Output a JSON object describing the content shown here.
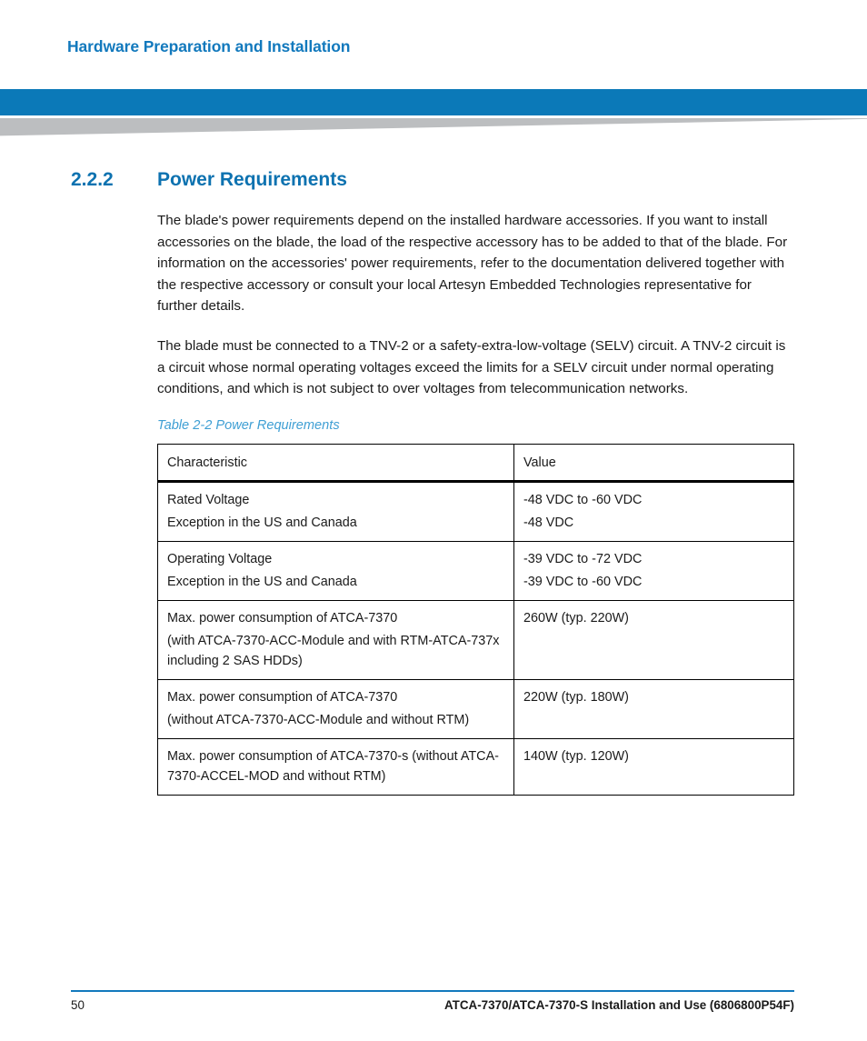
{
  "header": {
    "title": "Hardware Preparation and Installation",
    "accent_color": "#0b79b8",
    "title_color": "#1279bd"
  },
  "section": {
    "number": "2.2.2",
    "title": "Power Requirements",
    "heading_color": "#0d72b0"
  },
  "paragraphs": [
    "The blade's power requirements depend on the installed hardware accessories. If you want to install accessories on the blade, the load of the respective accessory has to be added to that of the blade. For information on the accessories' power requirements, refer to the documentation delivered together with the respective accessory or consult your local Artesyn Embedded Technologies representative for further details.",
    "The blade must be connected to a TNV-2 or a safety-extra-low-voltage (SELV) circuit. A TNV-2 circuit is a circuit whose normal operating voltages exceed the limits for a SELV circuit under normal operating conditions, and which is not subject to over voltages from telecommunication networks."
  ],
  "table": {
    "caption": "Table 2-2 Power Requirements",
    "caption_color": "#3f9fd4",
    "columns": [
      "Characteristic",
      "Value"
    ],
    "rows": [
      {
        "characteristic_lines": [
          "Rated Voltage",
          "Exception in the US and Canada"
        ],
        "value_lines": [
          "-48 VDC  to -60 VDC",
          "-48 VDC"
        ]
      },
      {
        "characteristic_lines": [
          "Operating Voltage",
          "Exception in the US and Canada"
        ],
        "value_lines": [
          "-39 VDC to -72 VDC",
          "-39 VDC to -60 VDC"
        ]
      },
      {
        "characteristic_lines": [
          "Max. power consumption of ATCA-7370",
          "(with ATCA-7370-ACC-Module and with RTM-ATCA-737x including 2 SAS HDDs)"
        ],
        "value_lines": [
          "260W (typ. 220W)"
        ]
      },
      {
        "characteristic_lines": [
          "Max. power consumption of ATCA-7370",
          "(without ATCA-7370-ACC-Module and without RTM)"
        ],
        "value_lines": [
          "220W (typ. 180W)"
        ]
      },
      {
        "characteristic_lines": [
          "Max. power consumption of ATCA-7370-s (without ATCA-7370-ACCEL-MOD and without RTM)"
        ],
        "value_lines": [
          "140W (typ. 120W)"
        ]
      }
    ]
  },
  "footer": {
    "page_number": "50",
    "document_title": "ATCA-7370/ATCA-7370-S Installation and Use (6806800P54F)",
    "rule_color": "#1279bd"
  }
}
